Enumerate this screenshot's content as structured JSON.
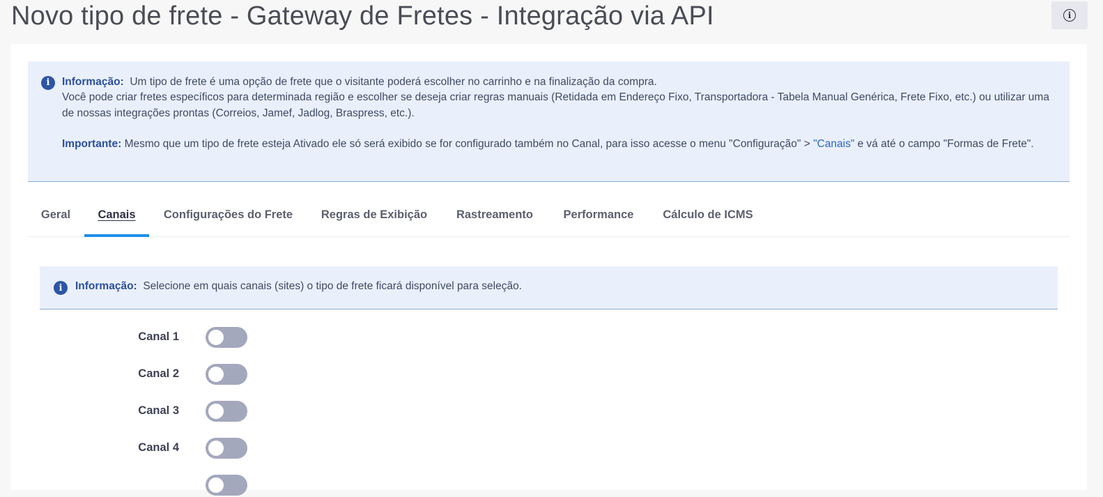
{
  "page": {
    "title": "Novo tipo de frete - Gateway de Fretes - Integração via API",
    "info_button_glyph": "i"
  },
  "alert_main": {
    "label": "Informação:",
    "text_line1": "Um tipo de frete é uma opção de frete que o visitante poderá escolher no carrinho e na finalização da compra.",
    "text_line2": "Você pode criar fretes específicos para determinada região e escolher se deseja criar regras manuais (Retidada em Endereço Fixo, Transportadora - Tabela Manual Genérica, Frete Fixo, etc.) ou utilizar uma de nossas integrações prontas (Correios, Jamef, Jadlog, Braspress, etc.).",
    "important_label": "Importante:",
    "important_text_before": "Mesmo que um tipo de frete esteja Ativado ele só será exibido se for configurado também no Canal, para isso acesse o menu \"Configuração\" > ",
    "important_link": "\"Canais\"",
    "important_text_after": " e vá até o campo \"Formas de Frete\".",
    "icon_glyph": "i"
  },
  "tabs": [
    {
      "label": "Geral",
      "active": false
    },
    {
      "label": "Canais",
      "active": true
    },
    {
      "label": "Configurações do Frete",
      "active": false
    },
    {
      "label": "Regras de Exibição",
      "active": false
    },
    {
      "label": "Rastreamento",
      "active": false
    },
    {
      "label": "Performance",
      "active": false
    },
    {
      "label": "Cálculo de ICMS",
      "active": false
    }
  ],
  "alert_sub": {
    "label": "Informação:",
    "text": "Selecione em quais canais (sites) o tipo de frete ficará disponível para seleção.",
    "icon_glyph": "i"
  },
  "channels": [
    {
      "label": "Canal 1",
      "enabled": false
    },
    {
      "label": "Canal 2",
      "enabled": false
    },
    {
      "label": "Canal 3",
      "enabled": false
    },
    {
      "label": "Canal 4",
      "enabled": false
    }
  ],
  "colors": {
    "accent": "#1f8fe8",
    "alert_bg": "#eaf0fb",
    "toggle_off": "#a4a8bd"
  }
}
